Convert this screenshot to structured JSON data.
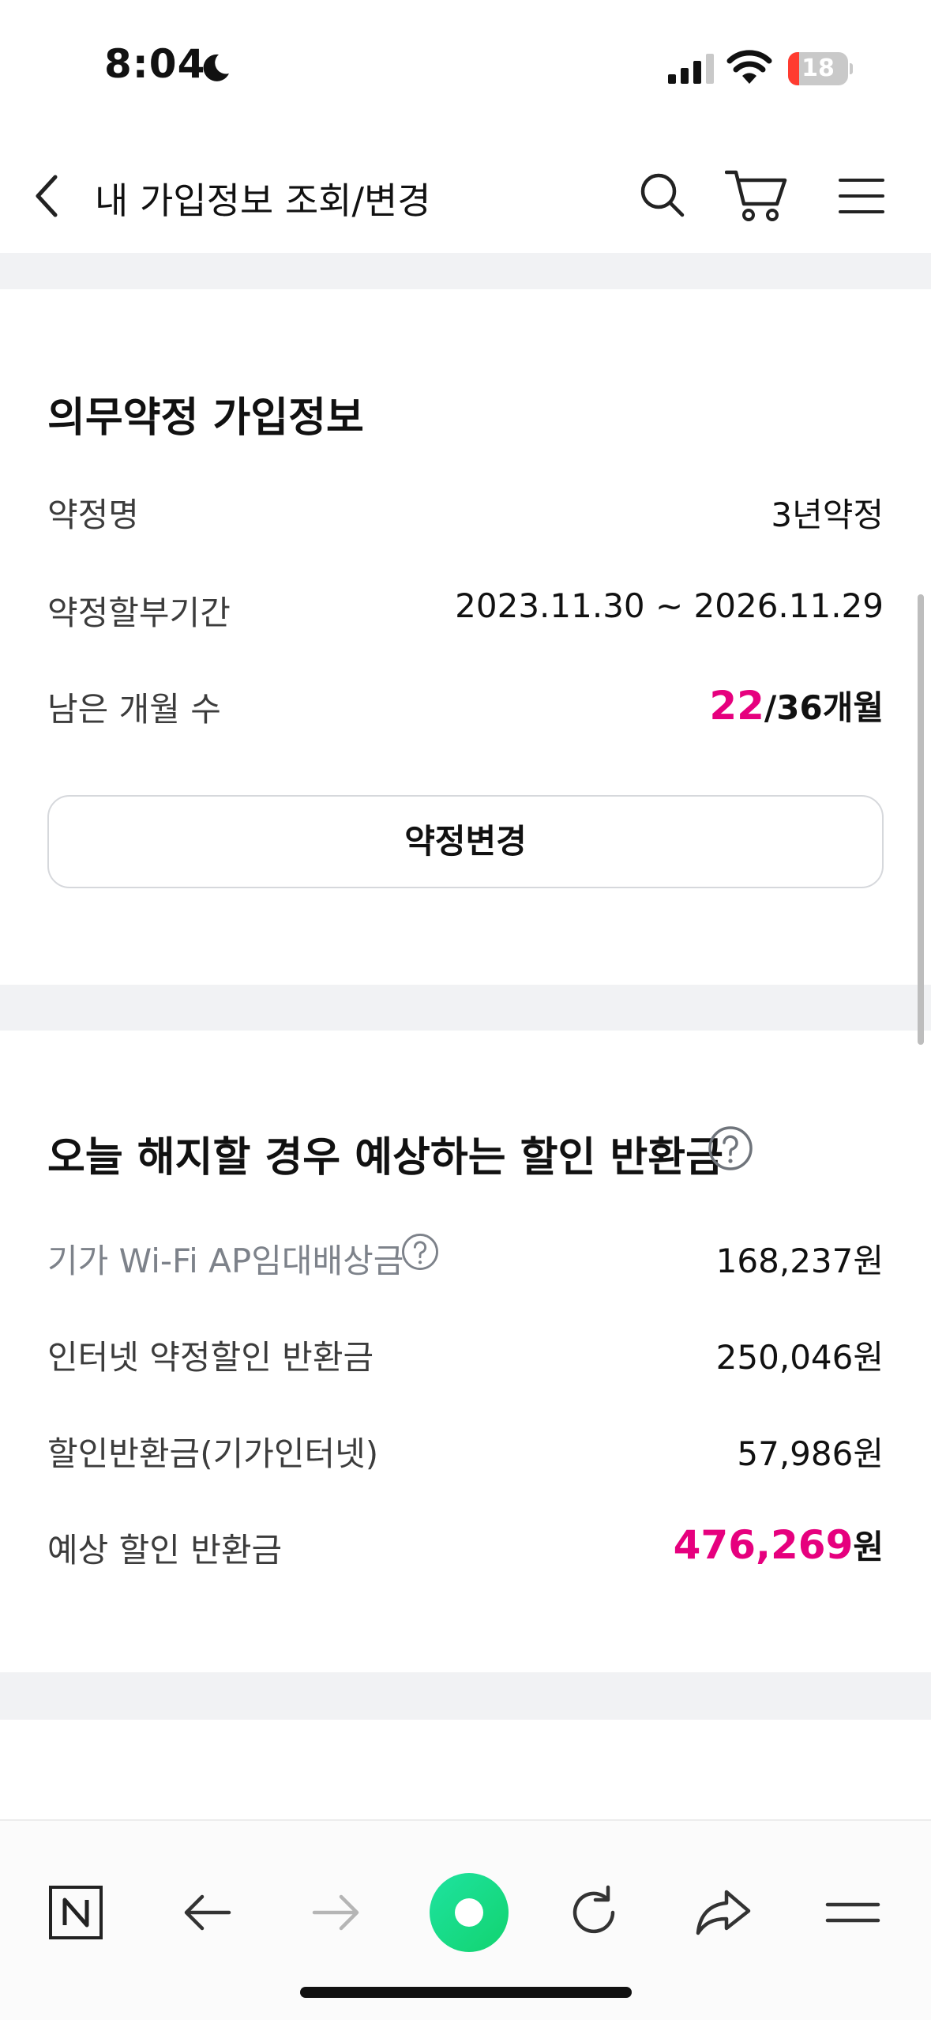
{
  "status_bar": {
    "time": "8:04",
    "battery_level": "18",
    "icons": [
      "moon-icon",
      "signal-icon",
      "wifi-icon",
      "battery-icon"
    ]
  },
  "header": {
    "title": "내 가입정보 조회/변경",
    "icons": [
      "back-icon",
      "search-icon",
      "cart-icon",
      "menu-icon"
    ]
  },
  "contract": {
    "title": "의무약정 가입정보",
    "rows": [
      {
        "label": "약정명",
        "value": "3년약정"
      },
      {
        "label": "약정할부기간",
        "value": "2023.11.30 ~ 2026.11.29"
      },
      {
        "label": "남은 개월 수",
        "remaining": "22",
        "total": "/36개월"
      }
    ],
    "change_button": "약정변경"
  },
  "refund": {
    "title": "오늘 해지할 경우 예상하는 할인 반환금",
    "rows": [
      {
        "label": "기가 Wi-Fi AP임대배상금",
        "value": "168,237원"
      },
      {
        "label": "인터넷 약정할인 반환금",
        "value": "250,046원"
      },
      {
        "label": "할인반환금(기가인터넷)",
        "value": "57,986원"
      }
    ],
    "total_label": "예상 할인 반환금",
    "total_amount": "476,269",
    "total_unit": "원"
  },
  "colors": {
    "accent": "#e6007e",
    "band": "#f1f2f4",
    "toolbar_green": "#1fd68a"
  },
  "toolbar": {
    "icons": [
      "naver-n-icon",
      "arrow-back-icon",
      "arrow-forward-icon",
      "green-dot-icon",
      "refresh-icon",
      "share-icon",
      "hamburger-icon"
    ]
  }
}
